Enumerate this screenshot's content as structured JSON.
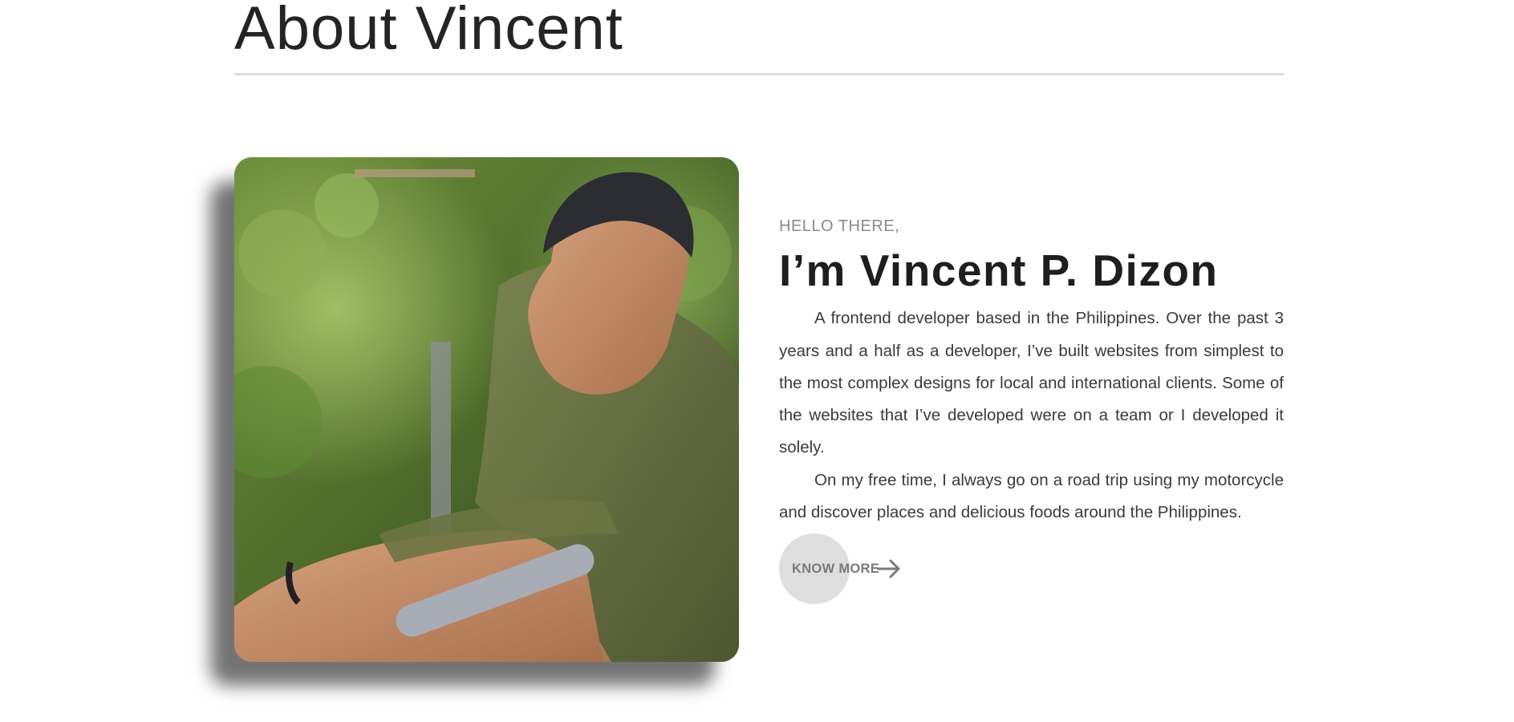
{
  "about": {
    "title": "About Vincent"
  },
  "photo": {
    "icon": "profile-photo"
  },
  "intro": {
    "greeting": "HELLO THERE,",
    "name": "I’m Vincent P. Dizon",
    "bio": [
      "A frontend developer based in the Philippines. Over the past 3 years and a half as a developer, I’ve built websites from simplest to the most complex designs for local and international clients. Some of the websites that I’ve developed were on a team or I developed it solely.",
      "On my free time, I always go on a road trip using my motorcycle and discover places and delicious foods around the Philippines."
    ]
  },
  "cta": {
    "label": "KNOW MORE",
    "icon": "arrow-right-icon"
  },
  "colors": {
    "title": "#242424",
    "rule": "#dddddd",
    "greeting": "#8a8a8a",
    "cta_circle": "#dedede",
    "cta_text": "#7a7a7a"
  }
}
